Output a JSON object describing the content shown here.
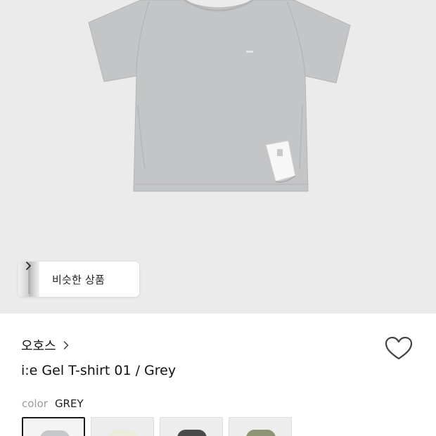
{
  "hero": {
    "image": "grey-tshirt-product-photo",
    "background": "#ebebeb",
    "shirt_color": "#c4c5c7"
  },
  "similar": {
    "label": "비슷한 상품",
    "icon": "chevron-right-icon"
  },
  "brand": {
    "name": "오호스",
    "icon": "chevron-right-icon"
  },
  "wishlist": {
    "icon": "heart-icon"
  },
  "product": {
    "name": "i:e Gel T-shirt 01 / Grey"
  },
  "color": {
    "label": "color",
    "value": "GREY",
    "swatches": [
      {
        "color": "#c6c7c9",
        "selected": true
      },
      {
        "color": "#ececdc",
        "selected": false
      },
      {
        "color": "#4a4a4a",
        "selected": false
      },
      {
        "color": "#8f9474",
        "selected": false
      }
    ]
  }
}
